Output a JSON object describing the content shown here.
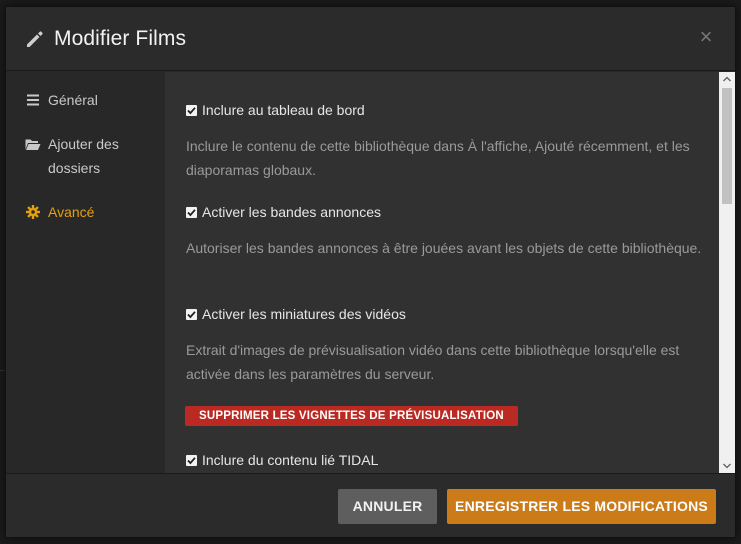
{
  "modal": {
    "title": "Modifier Films",
    "close_glyph": "×"
  },
  "sidebar": {
    "items": [
      {
        "label": "Général",
        "icon": "list-icon",
        "active": false
      },
      {
        "label": "Ajouter des dossiers",
        "icon": "folder-open-icon",
        "active": false
      },
      {
        "label": "Avancé",
        "icon": "gear-icon",
        "active": true
      }
    ]
  },
  "settings": [
    {
      "label": "Inclure au tableau de bord",
      "checked": true,
      "description": "Inclure le contenu de cette bibliothèque dans À l'affiche, Ajouté récemment, et les diaporamas globaux."
    },
    {
      "label": "Activer les bandes annonces",
      "checked": true,
      "description": "Autoriser les bandes annonces à être jouées avant les objets de cette bibliothèque."
    },
    {
      "label": "Activer les miniatures des vidéos",
      "checked": true,
      "description": "Extrait d'images de prévisualisation vidéo dans cette bibliothèque lorsqu'elle est activée dans les paramètres du serveur."
    },
    {
      "label": "Inclure du contenu lié TIDAL",
      "checked": true,
      "description": ""
    }
  ],
  "delete_previews_button": "SUPPRIMER LES VIGNETTES DE PRÉVISUALISATION",
  "footer": {
    "cancel_label": "ANNULER",
    "save_label": "ENREGISTRER LES MODIFICATIONS"
  },
  "colors": {
    "accent": "#e5a00d",
    "save_button": "#cc7b19",
    "danger_button": "#bb2a22",
    "cancel_button": "#5e5e5e"
  }
}
